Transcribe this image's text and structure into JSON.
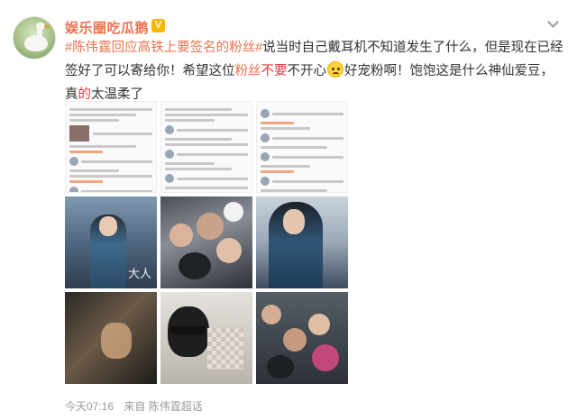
{
  "author": {
    "name": "娱乐圈吃瓜鹅",
    "verified_badge": "V",
    "avatar_icon": "goose-avatar-icon"
  },
  "post": {
    "hashtag": "#陈伟霆回应高铁上要签名的粉丝#",
    "text_1": "说当时自己戴耳机不知道发生了什么，但是现在已经签好了可以寄给你！希望这位",
    "fans_word": "粉丝",
    "bu_word": "不要",
    "text_2": "不开心",
    "text_3": "好宠粉啊！饱饱这是什么神仙爱豆，真",
    "de_word": "的",
    "text_4": "太温柔了"
  },
  "images": [
    {
      "kind": "screenshot"
    },
    {
      "kind": "screenshot"
    },
    {
      "kind": "screenshot"
    },
    {
      "kind": "photo",
      "overlay_text": "大人"
    },
    {
      "kind": "photo"
    },
    {
      "kind": "photo"
    },
    {
      "kind": "photo"
    },
    {
      "kind": "photo"
    },
    {
      "kind": "photo"
    }
  ],
  "footer": {
    "time": "今天07:16",
    "source": "来自 陈伟霆超话"
  },
  "colors": {
    "accent": "#eb7350",
    "highlight": "#e3393c",
    "muted": "#999999"
  }
}
